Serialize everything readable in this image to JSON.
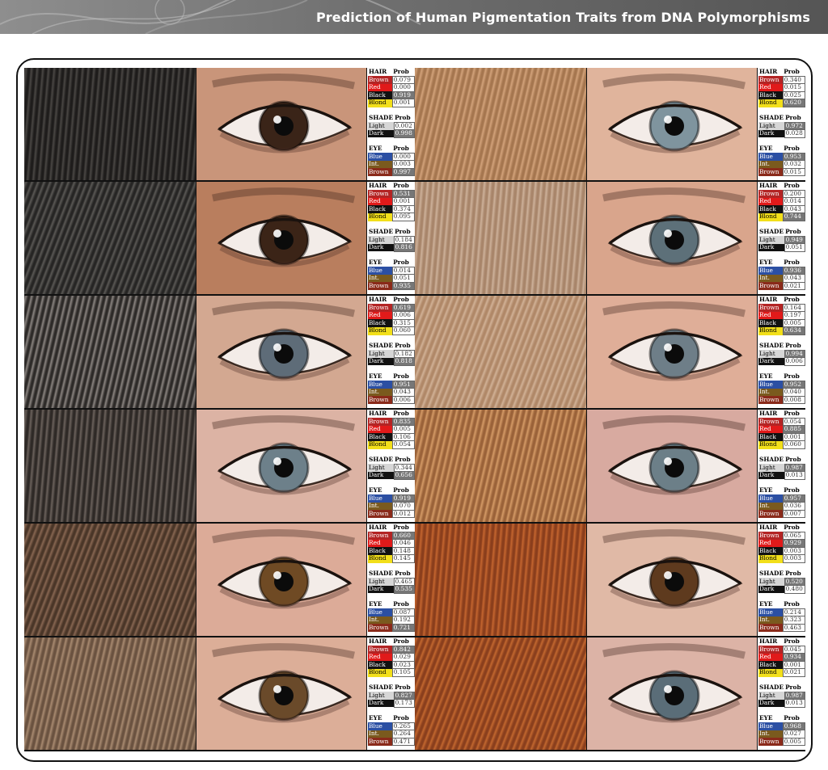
{
  "header": {
    "title": "Prediction of Human Pigmentation Traits from DNA Polymorphisms"
  },
  "labels": {
    "hair": "HAIR",
    "shade": "SHADE",
    "eye": "EYE",
    "prob": "Prob",
    "brown": "Brown",
    "red": "Red",
    "black": "Black",
    "blond": "Blond",
    "light": "Light",
    "dark": "Dark",
    "blue": "Blue",
    "int": "Int.",
    "eye_brown": "Brown"
  },
  "colors": {
    "frame": "#111111",
    "hair_brown": "#b32424",
    "hair_red": "#e11a1a",
    "hair_black": "#111111",
    "hair_blond": "#f2df1a",
    "shade_light": "#d6d6d6",
    "shade_dark": "#111111",
    "eye_blue": "#2b4fa3",
    "eye_int": "#7a5a1e",
    "eye_brown": "#8a2a1a"
  },
  "individuals": [
    {
      "hair_color": "#1e1c1b",
      "hair_hi": "#4a4744",
      "iris": "#3a2418",
      "skin": "#c9957a",
      "hair": [
        "0.079",
        "0.000",
        "0.919",
        "0.001"
      ],
      "shade": [
        "0.002",
        "0.998"
      ],
      "eye": [
        "0.000",
        "0.003",
        "0.997"
      ]
    },
    {
      "hair_color": "#a5764f",
      "hair_hi": "#d2a27a",
      "iris": "#7f949e",
      "skin": "#e0b49c",
      "hair": [
        "0.340",
        "0.015",
        "0.025",
        "0.620"
      ],
      "shade": [
        "0.972",
        "0.028"
      ],
      "eye": [
        "0.953",
        "0.032",
        "0.015"
      ]
    },
    {
      "hair_color": "#262524",
      "hair_hi": "#5a5855",
      "iris": "#3b2417",
      "skin": "#b97e5e",
      "hair": [
        "0.531",
        "0.001",
        "0.374",
        "0.095"
      ],
      "shade": [
        "0.184",
        "0.816"
      ],
      "eye": [
        "0.014",
        "0.051",
        "0.935"
      ]
    },
    {
      "hair_color": "#a8856a",
      "hair_hi": "#cdb19a",
      "iris": "#5d7079",
      "skin": "#d9a58c",
      "hair": [
        "0.200",
        "0.014",
        "0.043",
        "0.744"
      ],
      "shade": [
        "0.949",
        "0.051"
      ],
      "eye": [
        "0.936",
        "0.043",
        "0.021"
      ]
    },
    {
      "hair_color": "#2d2a28",
      "hair_hi": "#8a8480",
      "iris": "#5e6c78",
      "skin": "#d3a891",
      "hair": [
        "0.619",
        "0.006",
        "0.315",
        "0.060"
      ],
      "shade": [
        "0.182",
        "0.818"
      ],
      "eye": [
        "0.951",
        "0.043",
        "0.006"
      ]
    },
    {
      "hair_color": "#b08868",
      "hair_hi": "#d1b196",
      "iris": "#6e7e88",
      "skin": "#dfae98",
      "hair": [
        "0.164",
        "0.197",
        "0.005",
        "0.634"
      ],
      "shade": [
        "0.994",
        "0.006"
      ],
      "eye": [
        "0.952",
        "0.040",
        "0.008"
      ]
    },
    {
      "hair_color": "#2e2926",
      "hair_hi": "#6b625c",
      "iris": "#6d808a",
      "skin": "#dcb3a4",
      "hair": [
        "0.835",
        "0.005",
        "0.106",
        "0.054"
      ],
      "shade": [
        "0.344",
        "0.656"
      ],
      "eye": [
        "0.919",
        "0.070",
        "0.012"
      ]
    },
    {
      "hair_color": "#9a6239",
      "hair_hi": "#d49a66",
      "iris": "#6c7f88",
      "skin": "#d8aaa0",
      "hair": [
        "0.054",
        "0.885",
        "0.001",
        "0.060"
      ],
      "shade": [
        "0.987",
        "0.013"
      ],
      "eye": [
        "0.957",
        "0.036",
        "0.007"
      ]
    },
    {
      "hair_color": "#4a3628",
      "hair_hi": "#876651",
      "iris": "#6f4a24",
      "skin": "#dcab98",
      "hair": [
        "0.660",
        "0.046",
        "0.148",
        "0.145"
      ],
      "shade": [
        "0.465",
        "0.535"
      ],
      "eye": [
        "0.087",
        "0.192",
        "0.721"
      ]
    },
    {
      "hair_color": "#8a3e1c",
      "hair_hi": "#c4652f",
      "iris": "#5e3a1e",
      "skin": "#e0b9a6",
      "hair": [
        "0.065",
        "0.929",
        "0.003",
        "0.003"
      ],
      "shade": [
        "0.520",
        "0.480"
      ],
      "eye": [
        "0.214",
        "0.323",
        "0.463"
      ]
    },
    {
      "hair_color": "#6a5240",
      "hair_hi": "#a88a70",
      "iris": "#6a4a2a",
      "skin": "#dcae98",
      "hair": [
        "0.842",
        "0.029",
        "0.023",
        "0.105"
      ],
      "shade": [
        "0.827",
        "0.173"
      ],
      "eye": [
        "0.265",
        "0.264",
        "0.471"
      ]
    },
    {
      "hair_color": "#8a3f1d",
      "hair_hi": "#c2672f",
      "iris": "#5a6d78",
      "skin": "#dcb3a6",
      "hair": [
        "0.045",
        "0.934",
        "0.001",
        "0.021"
      ],
      "shade": [
        "0.987",
        "0.013"
      ],
      "eye": [
        "0.968",
        "0.027",
        "0.005"
      ]
    }
  ]
}
